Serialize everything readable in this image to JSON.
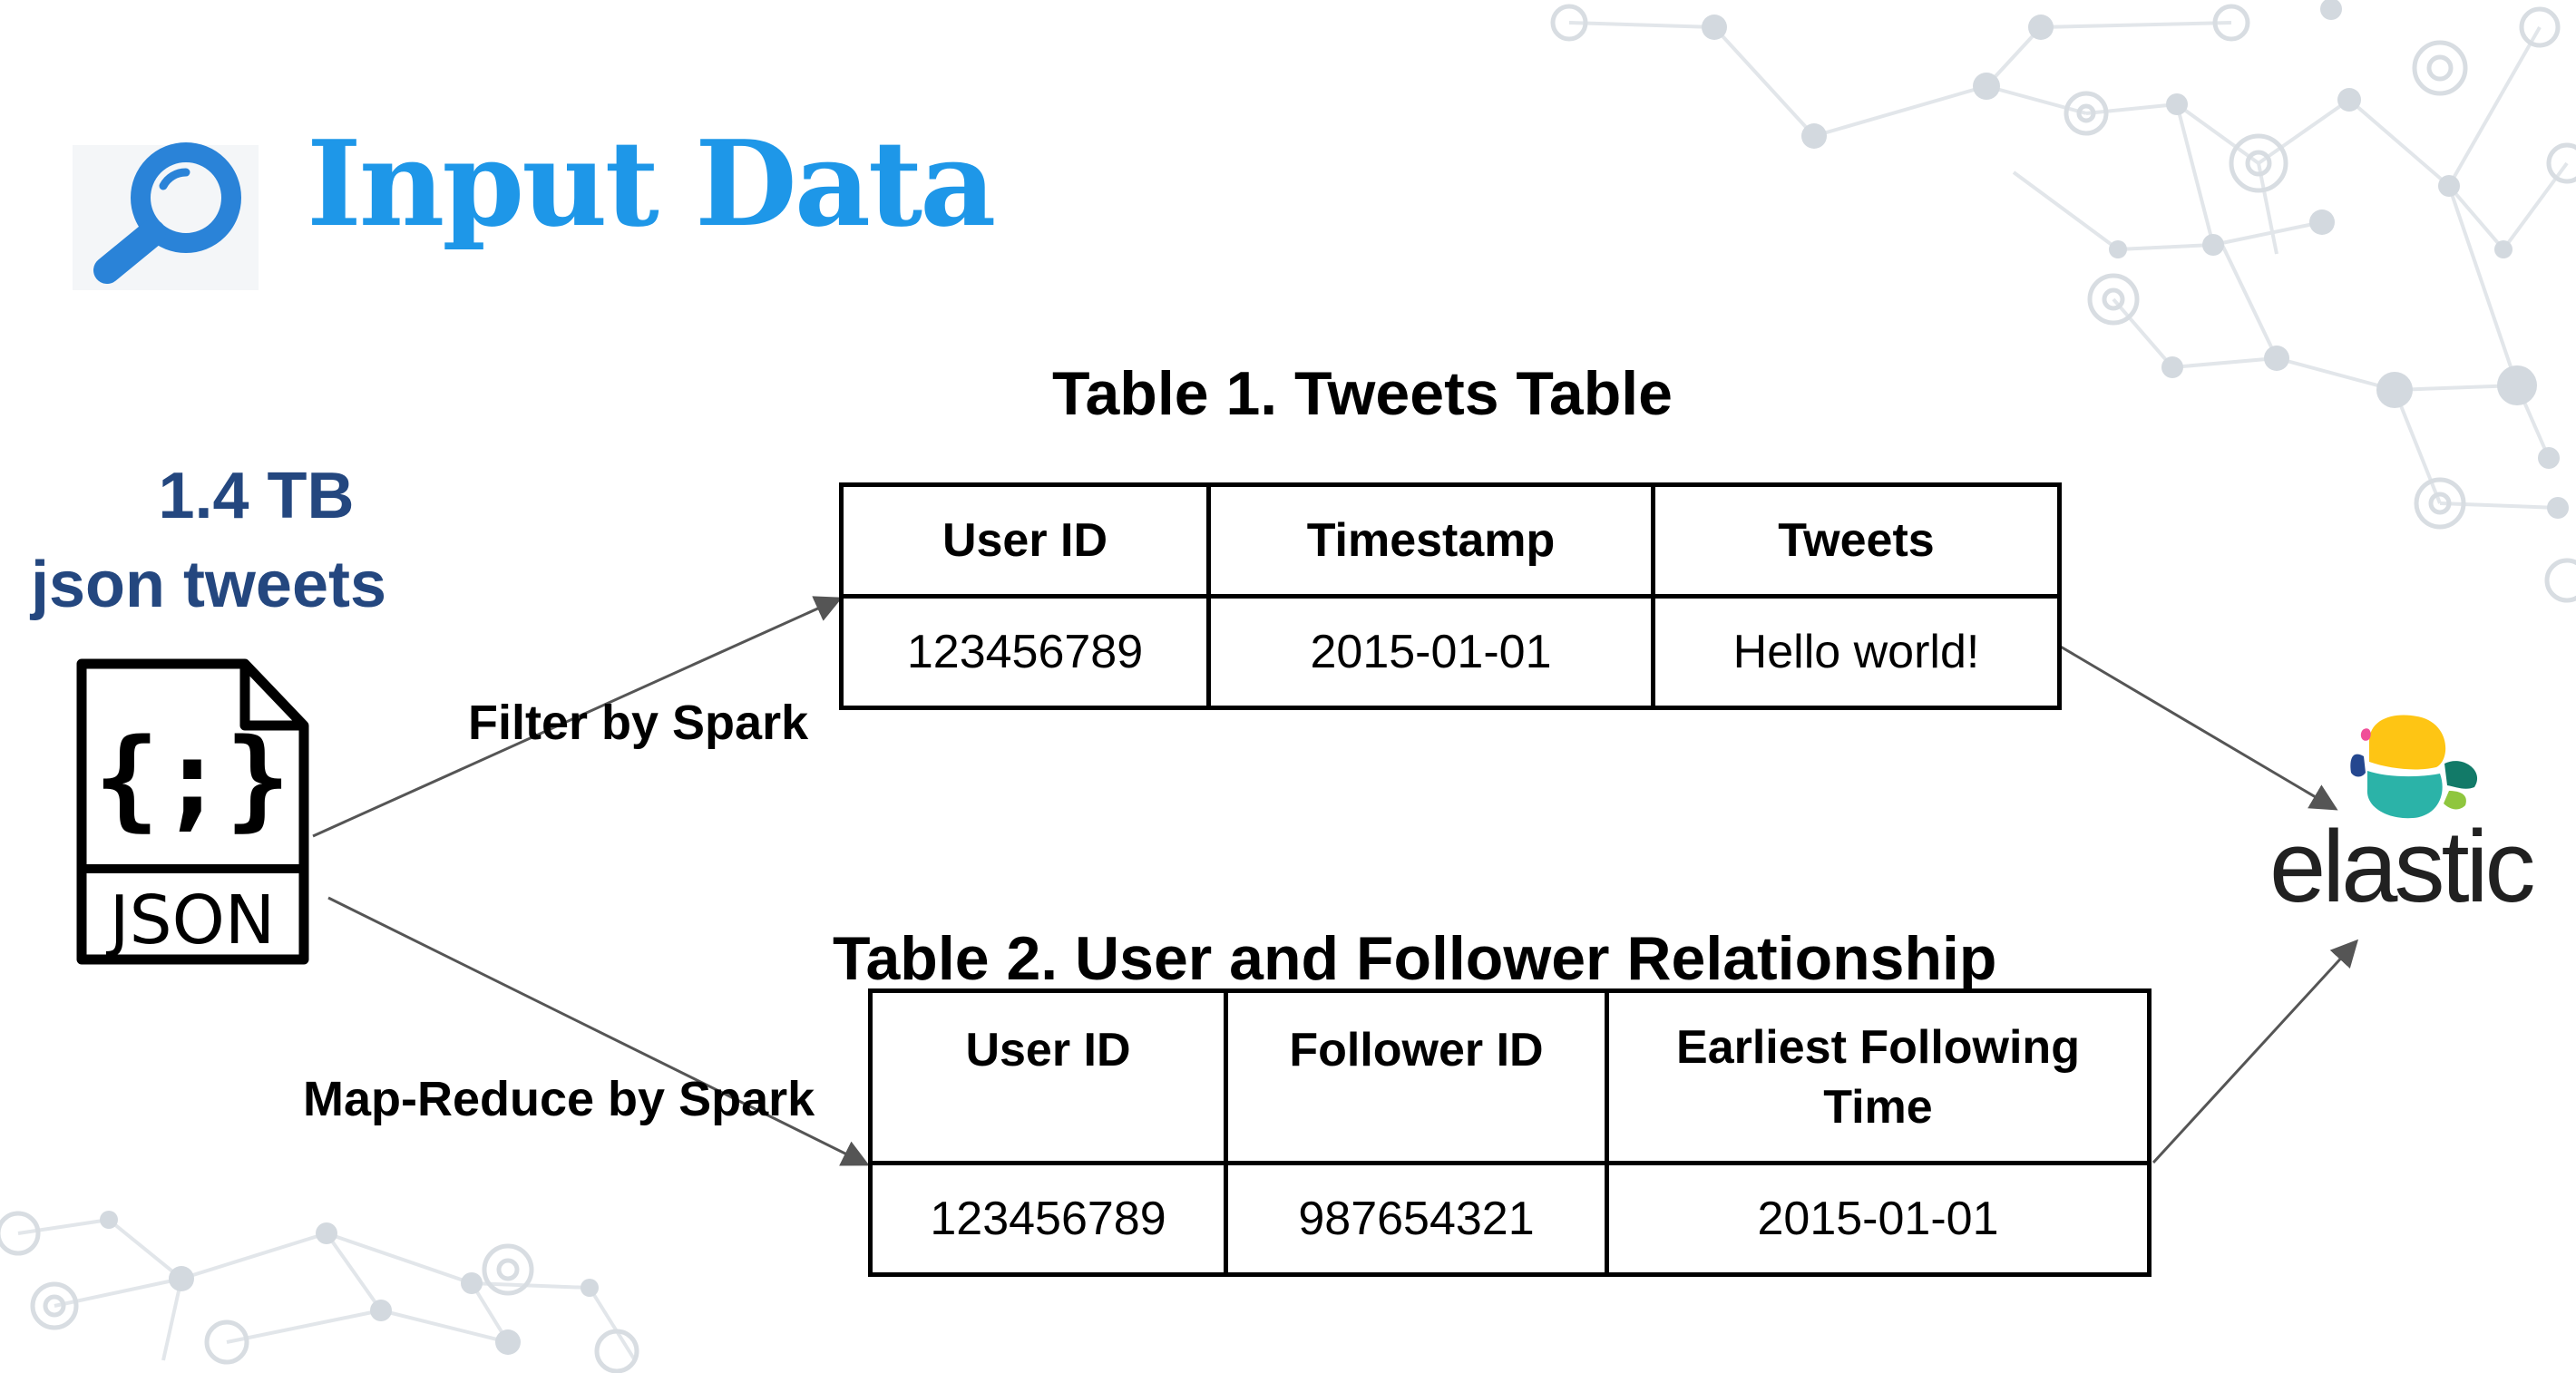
{
  "slide": {
    "title": "Input Data",
    "title_icon": "magnifier-icon"
  },
  "source": {
    "size_line1": "1.4 TB",
    "size_line2": "json tweets",
    "file_icon": "json-file-icon",
    "file_braces": "{;}",
    "file_label": "JSON"
  },
  "operations": {
    "filter_label": "Filter by Spark",
    "mapreduce_label": "Map-Reduce by Spark"
  },
  "table1": {
    "caption": "Table 1. Tweets Table",
    "headers": [
      "User ID",
      "Timestamp",
      "Tweets"
    ],
    "rows": [
      [
        "123456789",
        "2015-01-01",
        "Hello world!"
      ]
    ]
  },
  "table2": {
    "caption": "Table 2. User and Follower Relationship",
    "headers": [
      "User ID",
      "Follower ID",
      "Earliest Following Time"
    ],
    "rows": [
      [
        "123456789",
        "987654321",
        "2015-01-01"
      ]
    ]
  },
  "destination": {
    "logo_icon": "elastic-logo-icon",
    "wordmark": "elastic"
  },
  "colors": {
    "title_blue": "#1e97e8",
    "size_text_navy": "#24477f",
    "arrow_gray": "#555555",
    "network_gray": "#d3d9df",
    "elastic_yellow": "#fec514",
    "elastic_teal": "#2bb3a8",
    "elastic_dark_teal": "#127a68",
    "elastic_pink": "#f04e98",
    "elastic_blue": "#24478f",
    "elastic_green": "#8fc63e"
  }
}
